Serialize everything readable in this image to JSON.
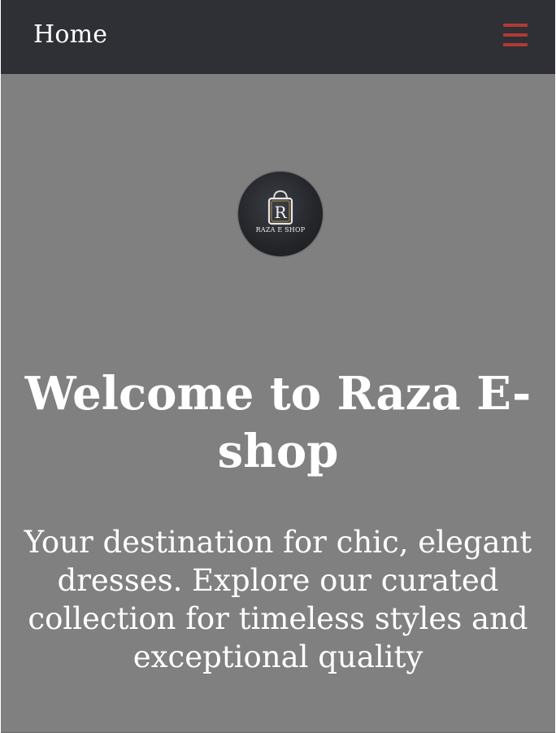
{
  "nav": {
    "home_label": "Home",
    "menu_icon": "hamburger-menu-icon",
    "menu_icon_color": "#b23a34",
    "background": "#2e3035"
  },
  "hero": {
    "background": "#808080",
    "logo_text": "RAZA E SHOP",
    "logo_monogram": "R",
    "title": "Welcome to Raza E-shop",
    "description": "Your destination for chic, elegant dresses. Explore our curated collection for timeless styles and exceptional quality"
  }
}
